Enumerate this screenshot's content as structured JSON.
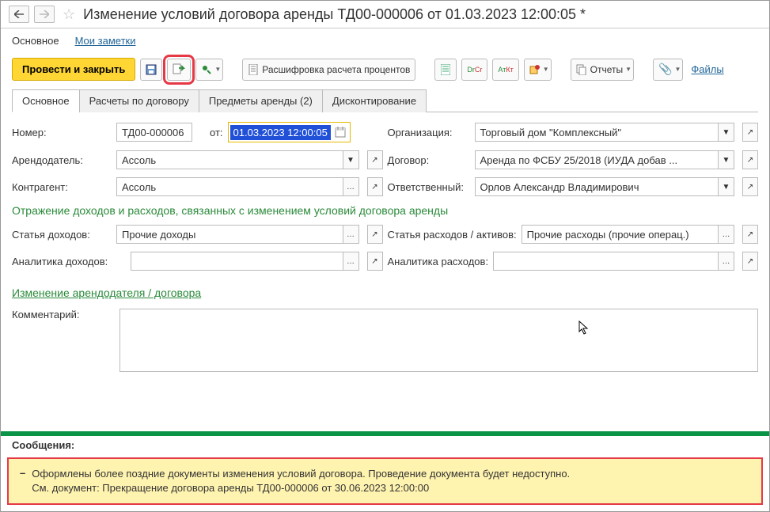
{
  "titlebar": {
    "title": "Изменение условий договора аренды ТД00-000006 от 01.03.2023 12:00:05 *"
  },
  "links": {
    "main": "Основное",
    "notes": "Мои заметки"
  },
  "toolbar": {
    "post_close": "Провести и закрыть",
    "calc": "Расшифровка расчета процентов",
    "reports": "Отчеты",
    "files": "Файлы"
  },
  "tabs": {
    "main": "Основное",
    "calcs": "Расчеты по договору",
    "items": "Предметы аренды (2)",
    "discount": "Дисконтирование"
  },
  "labels": {
    "number": "Номер:",
    "from": "от:",
    "org": "Организация:",
    "lessor": "Арендодатель:",
    "contract": "Договор:",
    "counterparty": "Контрагент:",
    "responsible": "Ответственный:",
    "income_article": "Статья доходов:",
    "expense_article": "Статья расходов / активов:",
    "income_analytics": "Аналитика доходов:",
    "expense_analytics": "Аналитика расходов:",
    "comment": "Комментарий:"
  },
  "values": {
    "number": "ТД00-000006",
    "date": "01.03.2023 12:00:05",
    "org": "Торговый дом \"Комплексный\"",
    "lessor": "Ассоль",
    "contract": "Аренда по ФСБУ 25/2018 (ИУДА  добав ...",
    "counterparty": "Ассоль",
    "responsible": "Орлов Александр Владимирович",
    "income_article": "Прочие доходы",
    "expense_article": "Прочие расходы (прочие операц.)",
    "income_analytics": "",
    "expense_analytics": "",
    "comment": ""
  },
  "sections": {
    "income_expense": "Отражение доходов и расходов, связанных с изменением условий договора аренды",
    "change_lessor": "Изменение арендодателя / договора"
  },
  "messages": {
    "header": "Сообщения:",
    "body": "Оформлены более поздние документы изменения условий договора. Проведение документа будет недоступно.\nСм. документ: Прекращение договора аренды ТД00-000006 от 30.06.2023 12:00:00"
  }
}
